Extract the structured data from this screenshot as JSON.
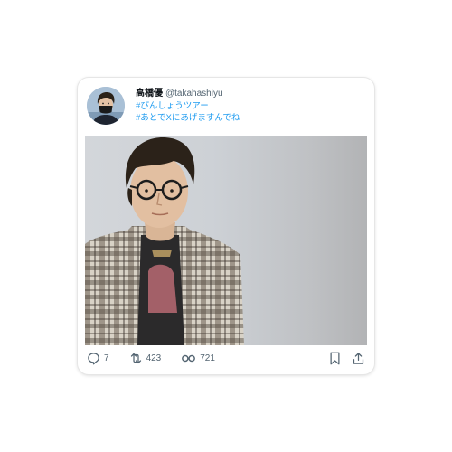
{
  "post": {
    "author": {
      "display_name": "高橋優",
      "handle": "@takahashiyu"
    },
    "lines": [
      "#ぴんしょうツアー",
      "#あとでXにあげますんでね"
    ],
    "image_alt": "Photo of a man with glasses wearing a plaid shirt over a graphic t-shirt"
  },
  "stats": {
    "replies": "7",
    "reposts": "423",
    "views": "721"
  },
  "icons": {
    "reply": "reply-icon",
    "repost": "repost-icon",
    "views": "views-icon",
    "bookmark": "bookmark-icon",
    "share": "share-icon"
  },
  "colors": {
    "hashtag": "#1d9bf0",
    "text": "#0f1419",
    "muted": "#536471"
  }
}
